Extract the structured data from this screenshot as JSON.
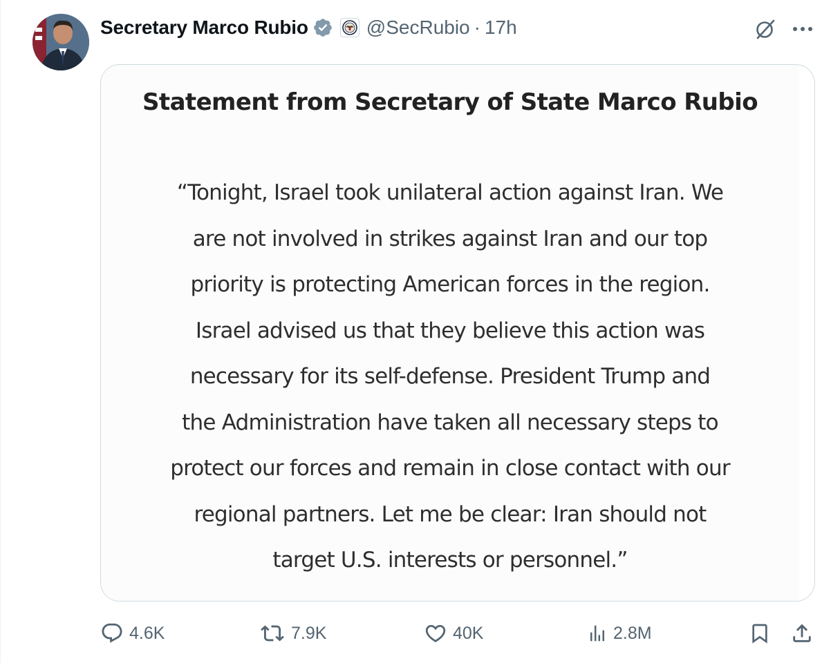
{
  "author": {
    "display_name": "Secretary Marco Rubio",
    "handle": "@SecRubio",
    "separator": "·",
    "time_ago": "17h",
    "avatar_icon": "portrait-avatar",
    "verified_icon": "verified-gray-badge",
    "affiliation_icon": "state-department-seal-icon"
  },
  "header_actions": {
    "grok_icon": "grok-icon",
    "more_icon": "more-horizontal-icon"
  },
  "statement": {
    "title": "Statement from Secretary of State Marco Rubio",
    "lines": [
      "“Tonight, Israel took unilateral action against Iran. We",
      "are not involved in strikes against Iran and our top",
      "priority is protecting American forces in the region.",
      "Israel advised us that they believe this action was",
      "necessary for its self-defense. President Trump and",
      "the Administration have taken all necessary steps to",
      "protect our forces and remain in close contact with our",
      "regional partners. Let me be clear: Iran should not",
      "target U.S. interests or personnel.”"
    ]
  },
  "metrics": {
    "replies": "4.6K",
    "reposts": "7.9K",
    "likes": "40K",
    "views": "2.8M"
  },
  "colors": {
    "text_primary": "#0f1419",
    "text_secondary": "#536471",
    "border": "#cfd9de",
    "verified_badge": "#829aab"
  }
}
